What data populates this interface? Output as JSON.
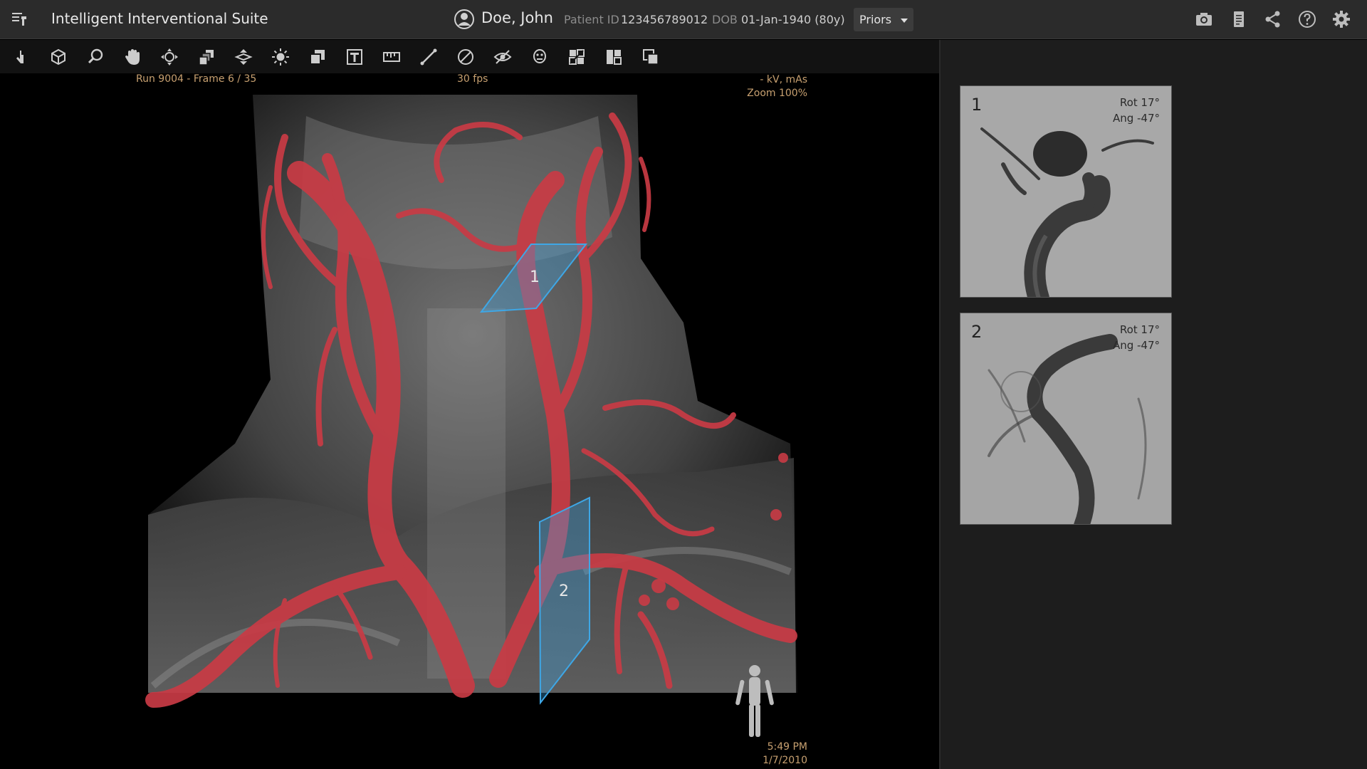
{
  "header": {
    "app_title": "Intelligent Interventional Suite",
    "patient_name": "Doe, John",
    "patient_id_label": "Patient ID",
    "patient_id": "123456789012",
    "dob_label": "DOB",
    "dob": "01-Jan-1940 (80y)",
    "priors_label": "Priors",
    "icons": [
      "camera-icon",
      "report-icon",
      "share-icon",
      "help-icon",
      "settings-icon"
    ]
  },
  "toolbar": {
    "tools": [
      "select-tool",
      "3d-volume-tool",
      "zoom-tool",
      "pan-tool",
      "rotate-tool",
      "copy-tool",
      "slab-tool",
      "brightness-tool",
      "overlay-tool",
      "text-tool",
      "ruler-tool",
      "measure-line-tool",
      "ellipse-tool",
      "hide-tool",
      "anatomy-tool",
      "compare-tool",
      "layout-tool",
      "export-tool"
    ]
  },
  "viewport": {
    "run_info": "Run 9004 - Frame 6 / 35",
    "fps": "30 fps",
    "kv": "- kV, mAs",
    "zoom": "Zoom 100%",
    "time": "5:49 PM",
    "date": "1/7/2010",
    "roi_1": "1",
    "roi_2": "2",
    "colors": {
      "vessel": "#c93b45",
      "roi": "#3ea7e6"
    }
  },
  "thumbnails": [
    {
      "num": "1",
      "rot": "Rot 17°",
      "ang": "Ang -47°"
    },
    {
      "num": "2",
      "rot": "Rot 17°",
      "ang": "Ang -47°"
    }
  ]
}
